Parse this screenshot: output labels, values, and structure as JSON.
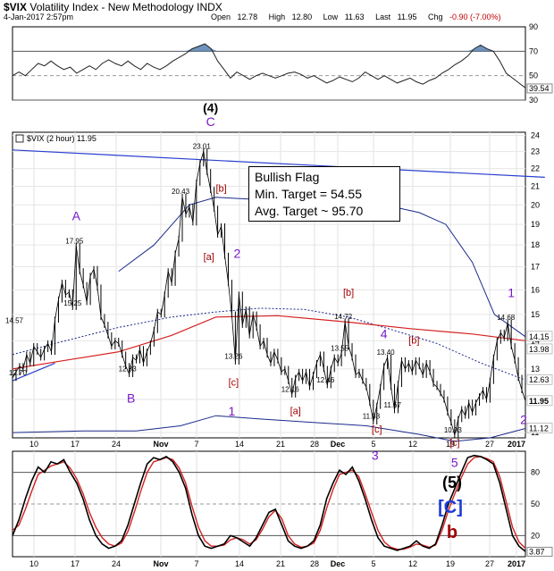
{
  "header": {
    "symbol": "$VIX",
    "name": "Volatility Index - New Methodology",
    "exchange": "INDX",
    "date": "4-Jan-2017 2:57pm",
    "open_label": "Open",
    "open": "12.78",
    "high_label": "High",
    "high": "12.80",
    "low_label": "Low",
    "low": "11.63",
    "last_label": "Last",
    "last": "11.95",
    "chg_label": "Chg",
    "chg": "-0.90 (-7.00%)"
  },
  "note": {
    "line1": "Bullish Flag",
    "line2": "Min. Target = 54.55",
    "line3": "Avg. Target ~ 95.70"
  },
  "colors": {
    "price": "#000000",
    "trendline": "#2a3fcf",
    "ma": "#d62020",
    "band": "#1a2a8a",
    "wave": "#7a18c8",
    "label_red": "#a00000",
    "rsi_fill": "#3f6fa8",
    "stoch_k": "#000000",
    "stoch_d": "#d62020",
    "brace": "#1d3ad6"
  },
  "chart_data": [
    {
      "type": "line",
      "panel": "RSI",
      "ylim": [
        30,
        90
      ],
      "y_ticks": [
        90,
        70,
        50,
        30
      ],
      "reference_lines": [
        70,
        50,
        30
      ],
      "last_value": "39.54",
      "values": [
        50,
        53,
        50,
        55,
        60,
        58,
        62,
        58,
        55,
        57,
        52,
        55,
        58,
        55,
        60,
        63,
        60,
        58,
        62,
        58,
        55,
        60,
        57,
        55,
        58,
        62,
        65,
        68,
        72,
        74,
        76,
        72,
        62,
        55,
        48,
        53,
        50,
        47,
        50,
        52,
        50,
        48,
        50,
        52,
        53,
        51,
        48,
        50,
        47,
        44,
        46,
        49,
        47,
        45,
        48,
        53,
        50,
        47,
        50,
        47,
        44,
        46,
        48,
        45,
        43,
        46,
        48,
        52,
        55,
        59,
        62,
        66,
        72,
        75,
        72,
        70,
        62,
        52,
        48,
        44,
        40
      ]
    },
    {
      "type": "line",
      "panel": "price",
      "legend": "$VIX (2 hour) 11.95",
      "ylim": [
        10.85,
        24.2
      ],
      "scale": "log",
      "y_ticks": [
        24,
        23,
        22,
        21,
        20,
        19,
        18,
        17,
        16,
        15,
        14,
        13,
        12,
        11
      ],
      "x_tick_labels": [
        "10",
        "17",
        "24",
        "Nov",
        "7",
        "14",
        "21",
        "28",
        "Dec",
        "5",
        "12",
        "19",
        "27",
        "2017"
      ],
      "right_labels": [
        "14.15",
        "13.98",
        "12.63",
        "11.95",
        "11.12"
      ],
      "points": [
        [
          0,
          12.7
        ],
        [
          4,
          12.9
        ],
        [
          8,
          13.1
        ],
        [
          12,
          13.0
        ],
        [
          16,
          13.5
        ],
        [
          20,
          13.2
        ],
        [
          24,
          13.8
        ],
        [
          28,
          13.6
        ],
        [
          32,
          13.4
        ],
        [
          36,
          13.7
        ],
        [
          40,
          13.9
        ],
        [
          44,
          13.6
        ],
        [
          48,
          14.8
        ],
        [
          52,
          15.6
        ],
        [
          56,
          16.3
        ],
        [
          60,
          15.8
        ],
        [
          64,
          15.9
        ],
        [
          68,
          15.3
        ],
        [
          72,
          17.95
        ],
        [
          76,
          16.8
        ],
        [
          80,
          16.2
        ],
        [
          84,
          15.5
        ],
        [
          88,
          16.6
        ],
        [
          92,
          16.9
        ],
        [
          96,
          16.1
        ],
        [
          100,
          14.9
        ],
        [
          104,
          14.6
        ],
        [
          108,
          14.2
        ],
        [
          112,
          13.8
        ],
        [
          116,
          14.0
        ],
        [
          120,
          13.9
        ],
        [
          124,
          13.5
        ],
        [
          128,
          13.1
        ],
        [
          132,
          12.83
        ],
        [
          136,
          13.4
        ],
        [
          140,
          13.3
        ],
        [
          144,
          13.7
        ],
        [
          148,
          13.2
        ],
        [
          152,
          13.6
        ],
        [
          156,
          13.9
        ],
        [
          160,
          14.4
        ],
        [
          164,
          15.1
        ],
        [
          168,
          15.0
        ],
        [
          172,
          15.8
        ],
        [
          176,
          16.8
        ],
        [
          180,
          16.3
        ],
        [
          184,
          17.6
        ],
        [
          188,
          18.3
        ],
        [
          192,
          20.43
        ],
        [
          196,
          19.5
        ],
        [
          200,
          19.9
        ],
        [
          204,
          19.1
        ],
        [
          208,
          21.2
        ],
        [
          212,
          22.3
        ],
        [
          216,
          23.01
        ],
        [
          220,
          21.8
        ],
        [
          224,
          20.8
        ],
        [
          228,
          19.8
        ],
        [
          232,
          18.5
        ],
        [
          236,
          18.9
        ],
        [
          240,
          17.5
        ],
        [
          244,
          16.3
        ],
        [
          248,
          15.0
        ],
        [
          252,
          13.26
        ],
        [
          256,
          15.8
        ],
        [
          260,
          14.6
        ],
        [
          264,
          15.2
        ],
        [
          268,
          14.2
        ],
        [
          272,
          15.0
        ],
        [
          276,
          14.5
        ],
        [
          280,
          13.8
        ],
        [
          284,
          14.0
        ],
        [
          288,
          13.5
        ],
        [
          292,
          13.2
        ],
        [
          296,
          13.6
        ],
        [
          300,
          13.3
        ],
        [
          304,
          12.9
        ],
        [
          308,
          13.0
        ],
        [
          312,
          12.6
        ],
        [
          316,
          12.16
        ],
        [
          320,
          12.7
        ],
        [
          324,
          12.9
        ],
        [
          328,
          12.6
        ],
        [
          332,
          12.9
        ],
        [
          336,
          12.4
        ],
        [
          340,
          12.8
        ],
        [
          344,
          13.2
        ],
        [
          348,
          13.5
        ],
        [
          352,
          13.0
        ],
        [
          356,
          12.46
        ],
        [
          360,
          13.0
        ],
        [
          364,
          13.4
        ],
        [
          368,
          13.2
        ],
        [
          372,
          13.55
        ],
        [
          376,
          14.72
        ],
        [
          380,
          13.8
        ],
        [
          384,
          13.4
        ],
        [
          388,
          12.8
        ],
        [
          392,
          12.9
        ],
        [
          396,
          12.6
        ],
        [
          400,
          12.4
        ],
        [
          404,
          11.9
        ],
        [
          408,
          11.33
        ],
        [
          412,
          11.8
        ],
        [
          416,
          12.4
        ],
        [
          420,
          13.1
        ],
        [
          424,
          13.4
        ],
        [
          428,
          12.4
        ],
        [
          432,
          11.67
        ],
        [
          436,
          12.5
        ],
        [
          440,
          13.3
        ],
        [
          444,
          13.0
        ],
        [
          448,
          13.2
        ],
        [
          452,
          12.9
        ],
        [
          456,
          13.3
        ],
        [
          460,
          13.1
        ],
        [
          464,
          12.8
        ],
        [
          468,
          13.2
        ],
        [
          472,
          12.9
        ],
        [
          476,
          12.5
        ],
        [
          480,
          12.4
        ],
        [
          484,
          12.2
        ],
        [
          488,
          12.0
        ],
        [
          492,
          11.6
        ],
        [
          496,
          11.3
        ],
        [
          500,
          10.93
        ],
        [
          504,
          11.4
        ],
        [
          508,
          11.7
        ],
        [
          512,
          11.5
        ],
        [
          516,
          11.9
        ],
        [
          520,
          11.6
        ],
        [
          524,
          11.9
        ],
        [
          528,
          12.1
        ],
        [
          532,
          12.3
        ],
        [
          536,
          12.0
        ],
        [
          540,
          12.6
        ],
        [
          544,
          13.4
        ],
        [
          548,
          14.0
        ],
        [
          552,
          14.3
        ],
        [
          556,
          14.1
        ],
        [
          560,
          14.68
        ],
        [
          564,
          13.8
        ],
        [
          568,
          13.3
        ],
        [
          572,
          12.7
        ],
        [
          576,
          12.3
        ],
        [
          580,
          11.95
        ]
      ],
      "moving_average": [
        [
          0,
          13.0
        ],
        [
          60,
          13.3
        ],
        [
          120,
          13.6
        ],
        [
          180,
          14.2
        ],
        [
          230,
          14.9
        ],
        [
          300,
          14.95
        ],
        [
          380,
          14.7
        ],
        [
          450,
          14.45
        ],
        [
          520,
          14.25
        ],
        [
          580,
          14.0
        ]
      ],
      "moving_average_dotted": [
        [
          0,
          13.5
        ],
        [
          60,
          14.0
        ],
        [
          120,
          14.5
        ],
        [
          180,
          14.9
        ],
        [
          230,
          15.1
        ],
        [
          280,
          15.25
        ],
        [
          330,
          15.2
        ],
        [
          380,
          14.9
        ],
        [
          430,
          14.4
        ],
        [
          480,
          13.9
        ],
        [
          530,
          13.2
        ],
        [
          580,
          12.63
        ]
      ],
      "upper_band": [
        [
          120,
          16.8
        ],
        [
          160,
          18.0
        ],
        [
          200,
          20.0
        ],
        [
          230,
          20.4
        ],
        [
          270,
          20.3
        ],
        [
          320,
          20.2
        ],
        [
          370,
          20.0
        ],
        [
          420,
          20.0
        ],
        [
          460,
          19.6
        ],
        [
          490,
          19.0
        ],
        [
          520,
          17.2
        ],
        [
          545,
          15.0
        ],
        [
          580,
          14.15
        ]
      ],
      "lower_band": [
        [
          0,
          11.0
        ],
        [
          80,
          11.05
        ],
        [
          140,
          11.05
        ],
        [
          190,
          11.2
        ],
        [
          230,
          11.5
        ],
        [
          280,
          11.4
        ],
        [
          340,
          11.3
        ],
        [
          400,
          11.2
        ],
        [
          460,
          10.95
        ],
        [
          500,
          10.75
        ],
        [
          540,
          10.85
        ],
        [
          580,
          11.12
        ]
      ],
      "trendline": [
        [
          0,
          23.1
        ],
        [
          602,
          21.5
        ]
      ],
      "support_line": [
        [
          0,
          12.6
        ],
        [
          48,
          13.2
        ]
      ],
      "labels": [
        {
          "text": "(4)",
          "x": 224,
          "y": 25.5,
          "color": "black"
        },
        {
          "text": "C",
          "x": 224,
          "y": 24.6,
          "color": "wave"
        },
        {
          "text": "A",
          "x": 72,
          "y": 19.2,
          "color": "wave"
        },
        {
          "text": "B",
          "x": 134,
          "y": 11.9,
          "color": "wave"
        },
        {
          "text": "2",
          "x": 254,
          "y": 17.4,
          "color": "wave"
        },
        {
          "text": "1",
          "x": 248,
          "y": 11.5,
          "color": "wave"
        },
        {
          "text": "4",
          "x": 420,
          "y": 14.1,
          "color": "wave"
        },
        {
          "text": "3",
          "x": 410,
          "y": 10.25,
          "color": "wave"
        },
        {
          "text": "5",
          "x": 500,
          "y": 10.05,
          "color": "wave"
        },
        {
          "text": "1",
          "x": 564,
          "y": 15.7,
          "color": "wave"
        },
        {
          "text": "2",
          "x": 578,
          "y": 11.25,
          "color": "wave"
        },
        {
          "text": "[b]",
          "x": 236,
          "y": 20.7,
          "color": "label_red"
        },
        {
          "text": "[a]",
          "x": 222,
          "y": 17.3,
          "color": "label_red"
        },
        {
          "text": "[c]",
          "x": 250,
          "y": 12.45,
          "color": "label_red"
        },
        {
          "text": "[b]",
          "x": 380,
          "y": 15.75,
          "color": "label_red"
        },
        {
          "text": "[a]",
          "x": 320,
          "y": 11.55,
          "color": "label_red"
        },
        {
          "text": "[b]",
          "x": 454,
          "y": 13.9,
          "color": "label_red"
        },
        {
          "text": "[c]",
          "x": 412,
          "y": 11.0,
          "color": "label_red"
        },
        {
          "text": "[c]",
          "x": 500,
          "y": 10.62,
          "color": "label_red"
        }
      ],
      "price_labels": [
        {
          "text": "14.57",
          "x": 4,
          "y": 14.57
        },
        {
          "text": "12.70",
          "x": 8,
          "y": 12.7
        },
        {
          "text": "17.95",
          "x": 72,
          "y": 17.95
        },
        {
          "text": "15.25",
          "x": 70,
          "y": 15.25
        },
        {
          "text": "12.83",
          "x": 132,
          "y": 12.83
        },
        {
          "text": "20.43",
          "x": 192,
          "y": 20.43
        },
        {
          "text": "23.01",
          "x": 216,
          "y": 23.01
        },
        {
          "text": "13.26",
          "x": 252,
          "y": 13.26
        },
        {
          "text": "12.16",
          "x": 316,
          "y": 12.16
        },
        {
          "text": "12.46",
          "x": 356,
          "y": 12.46
        },
        {
          "text": "13.55",
          "x": 372,
          "y": 13.55
        },
        {
          "text": "14.72",
          "x": 376,
          "y": 14.72
        },
        {
          "text": "13.40",
          "x": 424,
          "y": 13.4
        },
        {
          "text": "11.33",
          "x": 408,
          "y": 11.33
        },
        {
          "text": "11.67",
          "x": 432,
          "y": 11.67
        },
        {
          "text": "10.93",
          "x": 500,
          "y": 10.93
        },
        {
          "text": "14.68",
          "x": 560,
          "y": 14.68
        }
      ]
    },
    {
      "type": "line",
      "panel": "stochastic",
      "ylim": [
        0,
        100
      ],
      "y_ticks": [
        80,
        50,
        20
      ],
      "reference_lines": [
        80,
        50,
        20
      ],
      "last_value": "3.87",
      "labels": [
        {
          "text": "(5)",
          "color": "black"
        },
        {
          "text": "[C]",
          "color": "brace"
        },
        {
          "text": "b",
          "color": "label_red"
        }
      ],
      "k_values": [
        20,
        35,
        55,
        72,
        85,
        80,
        90,
        88,
        92,
        80,
        70,
        55,
        35,
        20,
        12,
        8,
        10,
        15,
        30,
        50,
        70,
        88,
        94,
        92,
        95,
        90,
        80,
        65,
        40,
        20,
        10,
        8,
        10,
        12,
        20,
        18,
        14,
        10,
        18,
        30,
        42,
        45,
        30,
        15,
        10,
        8,
        10,
        15,
        30,
        55,
        70,
        82,
        78,
        85,
        72,
        55,
        35,
        18,
        10,
        8,
        6,
        8,
        10,
        15,
        10,
        8,
        12,
        30,
        50,
        65,
        80,
        94,
        96,
        95,
        92,
        88,
        70,
        45,
        20,
        10,
        5
      ],
      "d_values": [
        25,
        30,
        45,
        62,
        78,
        82,
        86,
        88,
        90,
        84,
        74,
        60,
        42,
        28,
        18,
        12,
        10,
        13,
        24,
        42,
        62,
        80,
        90,
        92,
        94,
        92,
        84,
        70,
        48,
        28,
        15,
        10,
        10,
        11,
        16,
        18,
        16,
        12,
        16,
        26,
        38,
        44,
        36,
        20,
        12,
        9,
        10,
        13,
        25,
        46,
        64,
        78,
        80,
        82,
        76,
        60,
        42,
        25,
        14,
        9,
        7,
        7,
        9,
        12,
        11,
        9,
        11,
        25,
        44,
        60,
        75,
        88,
        94,
        95,
        93,
        90,
        76,
        52,
        28,
        14,
        8
      ]
    }
  ]
}
